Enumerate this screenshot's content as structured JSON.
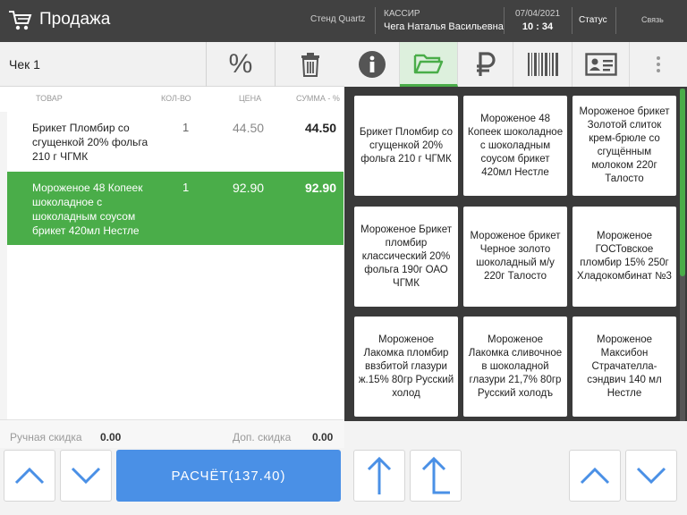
{
  "header": {
    "title": "Продажа",
    "stand": "Стенд Quartz",
    "cashier_label": "КАССИР",
    "cashier_name": "Чега Наталья Васильевна",
    "date": "07/04/2021",
    "time": "10 : 34",
    "status": "Статус",
    "connection": "Связь"
  },
  "check": {
    "title": "Чек 1",
    "percent_label": "%",
    "columns": {
      "item": "ТОВАР",
      "qty": "КОЛ-ВО",
      "price": "ЦЕНА",
      "sum": "СУММА - %"
    },
    "rows": [
      {
        "name": "Брикет Пломбир со сгущенкой 20% фольга 210 г ЧГМК",
        "qty": "1",
        "price": "44.50",
        "sum": "44.50",
        "selected": false
      },
      {
        "name": "Мороженое 48 Копеек шоколадное с шоколадным соусом брикет 420мл Нестле",
        "qty": "1",
        "price": "92.90",
        "sum": "92.90",
        "selected": true
      }
    ],
    "manual_discount_label": "Ручная скидка",
    "manual_discount_value": "0.00",
    "extra_discount_label": "Доп. скидка",
    "extra_discount_value": "0.00",
    "pay_label": "РАСЧЁТ(137.40)"
  },
  "products": [
    "Брикет Пломбир со сгущенкой 20% фольга 210 г ЧГМК",
    "Мороженое 48 Копеек шоколадное с шоколадным соусом брикет 420мл Нестле",
    "Мороженое брикет Золотой слиток крем-брюле со сгущённым молоком 220г Талосто",
    "Мороженое Брикет пломбир классический 20% фольга 190г ОАО ЧГМК",
    "Мороженое брикет Черное золото шоколадный м/у 220г Талосто",
    "Мороженое ГОСТовское пломбир 15% 250г Хладокомбинат №3",
    "Мороженое Лакомка пломбир ввзбитой глазури ж.15% 80гр Русский холод",
    "Мороженое Лакомка сливочное в шоколадной глазури 21,7% 80гр Русский холодъ",
    "Мороженое Максибон Страчателла-сэндвич 140 мл Нестле"
  ],
  "icons": {
    "tabs": [
      "info-icon",
      "folder-open-icon",
      "ruble-icon",
      "barcode-icon",
      "id-card-icon",
      "more-vert-icon"
    ]
  },
  "colors": {
    "accent_green": "#4aad49",
    "accent_blue": "#4a90e6",
    "header_bg": "#414141"
  }
}
